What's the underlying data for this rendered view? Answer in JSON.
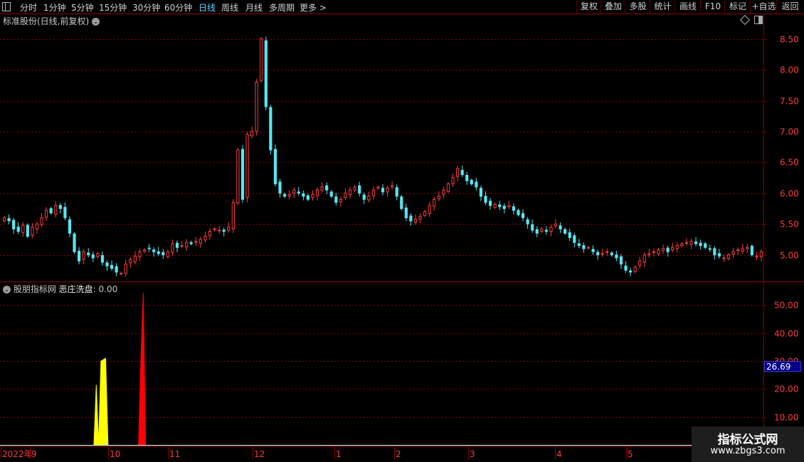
{
  "toolbar": {
    "timeframes": [
      "分时",
      "1分钟",
      "5分钟",
      "15分钟",
      "30分钟",
      "60分钟",
      "日线",
      "周线",
      "月线",
      "多周期",
      "更多 >"
    ],
    "active_timeframe": "日线",
    "right_buttons": [
      "复权",
      "叠加",
      "多股",
      "统计",
      "画线",
      "F10",
      "标记",
      "+自选",
      "返回"
    ]
  },
  "main_chart": {
    "title": "标准股份(日线,前复权)",
    "y_ticks": [
      "8.50",
      "8.00",
      "7.50",
      "7.00",
      "6.50",
      "6.00",
      "5.50",
      "5.00"
    ],
    "y_values": [
      8.5,
      8.0,
      7.5,
      7.0,
      6.5,
      6.0,
      5.5,
      5.0
    ],
    "y_range": [
      4.58,
      8.9
    ]
  },
  "indicator": {
    "source": "股朋指标网",
    "name": "恶庄洗盘",
    "value": "0.00",
    "y_ticks": [
      "50.00",
      "40.00",
      "30.00",
      "20.00",
      "10.00"
    ],
    "y_values": [
      50,
      40,
      30,
      20,
      10
    ],
    "y_range": [
      0,
      58
    ],
    "current_value_label": "26.69"
  },
  "date_axis": {
    "labels": [
      "2022年",
      "9",
      "10",
      "11",
      "12",
      "1",
      "2",
      "3",
      "4",
      "5"
    ]
  },
  "watermark": {
    "title": "指标公式网",
    "url": "www.zbgs3.com"
  },
  "colors": {
    "up": "#ff3b3b",
    "down": "#55e6f2",
    "signal_yellow": "#ffff00",
    "signal_red": "#ff0000",
    "grid": "#8a0000"
  },
  "chart_data": {
    "type": "candlestick",
    "closes": [
      5.6,
      5.55,
      5.42,
      5.38,
      5.48,
      5.3,
      5.45,
      5.5,
      5.6,
      5.72,
      5.68,
      5.8,
      5.75,
      5.6,
      5.35,
      5.05,
      4.9,
      5.05,
      5.0,
      4.95,
      5.02,
      4.88,
      4.82,
      4.78,
      4.72,
      4.7,
      4.85,
      4.92,
      4.98,
      5.05,
      5.08,
      5.1,
      5.05,
      5.02,
      5.0,
      5.05,
      5.18,
      5.12,
      5.15,
      5.2,
      5.18,
      5.22,
      5.25,
      5.3,
      5.38,
      5.42,
      5.4,
      5.38,
      5.45,
      5.85,
      6.7,
      5.9,
      6.95,
      7.0,
      7.8,
      8.5,
      7.4,
      6.7,
      6.15,
      6.0,
      5.95,
      5.98,
      6.05,
      6.0,
      5.95,
      5.9,
      5.98,
      6.05,
      6.1,
      6.05,
      5.95,
      5.85,
      5.9,
      6.0,
      6.05,
      6.1,
      6.0,
      5.9,
      5.95,
      6.05,
      6.1,
      6.02,
      6.08,
      6.12,
      5.95,
      5.75,
      5.6,
      5.55,
      5.58,
      5.62,
      5.7,
      5.8,
      5.9,
      5.95,
      6.05,
      6.15,
      6.25,
      6.4,
      6.3,
      6.2,
      6.15,
      6.1,
      5.95,
      5.85,
      5.8,
      5.82,
      5.78,
      5.75,
      5.8,
      5.72,
      5.65,
      5.6,
      5.5,
      5.4,
      5.35,
      5.42,
      5.38,
      5.45,
      5.5,
      5.42,
      5.35,
      5.28,
      5.2,
      5.15,
      5.1,
      5.12,
      5.05,
      5.0,
      5.02,
      5.05,
      5.0,
      4.95,
      4.85,
      4.75,
      4.72,
      4.8,
      4.9,
      5.0,
      5.02,
      5.05,
      5.08,
      5.1,
      5.05,
      5.12,
      5.15,
      5.18,
      5.2,
      5.22,
      5.18,
      5.15,
      5.12,
      5.1,
      5.0,
      4.98,
      4.95,
      5.0,
      5.05,
      5.08,
      5.1,
      5.12,
      5.0,
      4.98,
      5.05
    ],
    "indicator_series": [
      {
        "name": "恶庄洗盘",
        "color": "yellow",
        "x_index": [
          40,
          41,
          42,
          43,
          44,
          45,
          46
        ],
        "values": [
          0,
          21.5,
          0,
          30,
          30.5,
          31,
          0
        ]
      },
      {
        "name": "恶庄洗盘",
        "color": "red",
        "x_index": [
          59,
          60,
          61,
          62
        ],
        "values": [
          0,
          31,
          54.5,
          0
        ]
      }
    ]
  }
}
